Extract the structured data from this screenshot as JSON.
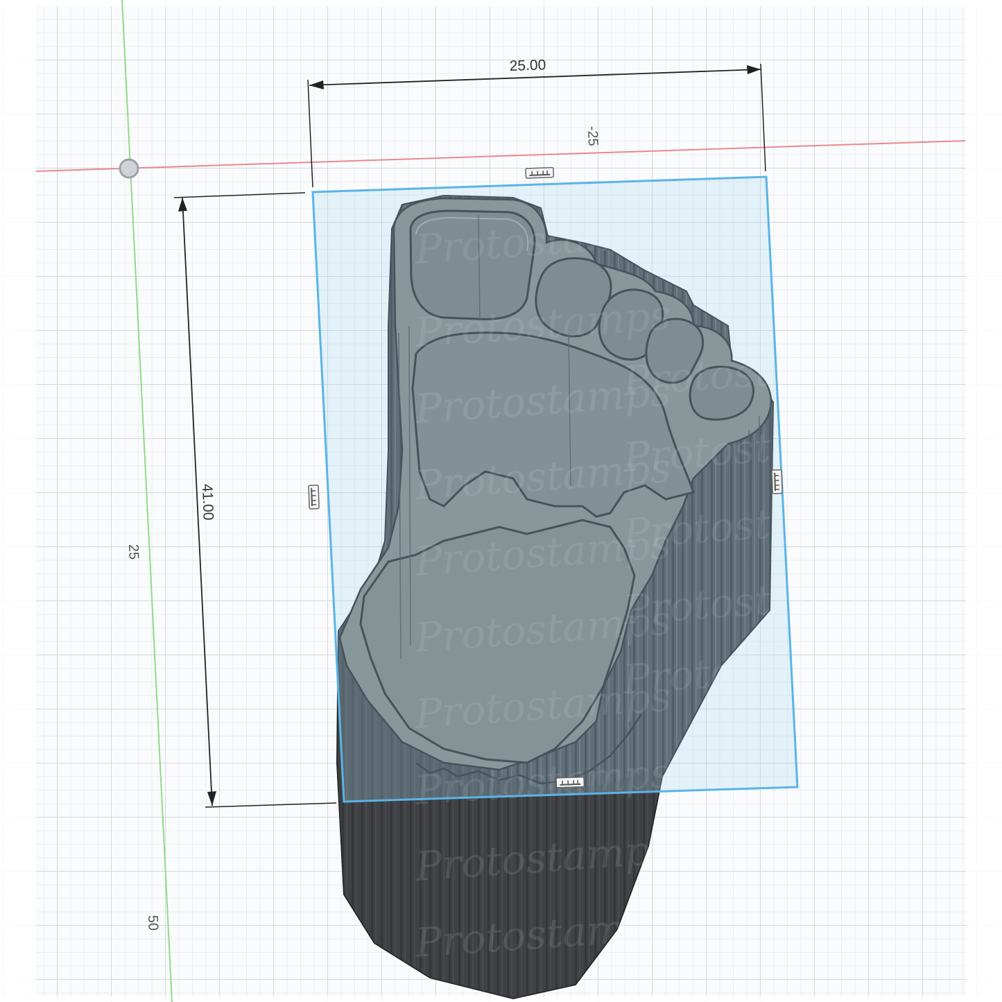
{
  "dimensions": {
    "width_value": "25.00",
    "height_value": "41.00"
  },
  "axis_labels": {
    "top_ruler": "-25",
    "left_ruler_upper": "25",
    "left_ruler_lower": "50"
  },
  "watermark": "Protostamps",
  "colors": {
    "x_axis": "#e8898d",
    "y_axis": "#8fdc85",
    "selection": "#5ab4e6",
    "body_dark": "#3f4144",
    "body_face": "#7b7e79"
  }
}
